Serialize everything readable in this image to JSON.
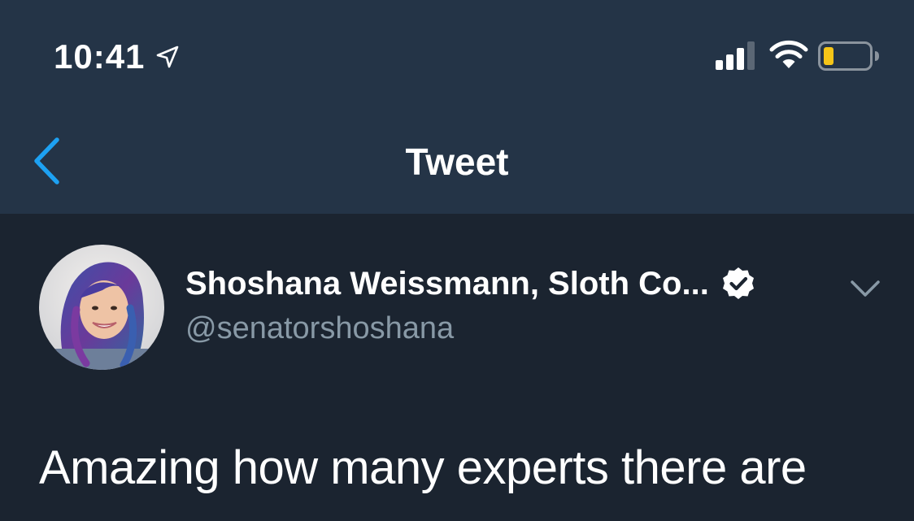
{
  "status_bar": {
    "time": "10:41",
    "icons": {
      "location": "location-arrow-icon",
      "signal": "cellular-signal-icon",
      "wifi": "wifi-icon",
      "battery": "battery-low-icon"
    },
    "battery_color": "#f5c518"
  },
  "nav": {
    "title": "Tweet",
    "back_icon": "chevron-left-icon",
    "accent_color": "#1da1f2"
  },
  "tweet": {
    "author": {
      "name": "Shoshana Weissmann, Sloth Co...",
      "handle": "@senatorshoshana",
      "verified": true
    },
    "text": "Amazing how many experts there are",
    "menu_icon": "chevron-down-icon"
  },
  "colors": {
    "nav_background": "#243447",
    "content_background": "#1b2430",
    "secondary_text": "#8899a6"
  }
}
